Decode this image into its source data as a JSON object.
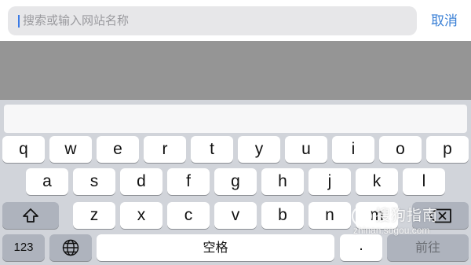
{
  "search": {
    "placeholder": "搜索或输入网站名称",
    "cancel_label": "取消"
  },
  "keyboard": {
    "row1": [
      "q",
      "w",
      "e",
      "r",
      "t",
      "y",
      "u",
      "i",
      "o",
      "p"
    ],
    "row2": [
      "a",
      "s",
      "d",
      "f",
      "g",
      "h",
      "j",
      "k",
      "l"
    ],
    "row3": [
      "z",
      "x",
      "c",
      "v",
      "b",
      "n",
      "m"
    ],
    "numbers_label": "123",
    "space_label": "空格",
    "period_label": ".",
    "go_label": "前往",
    "shift_icon": "shift-icon",
    "delete_icon": "delete-icon",
    "globe_icon": "globe-icon"
  },
  "watermark": {
    "name": "搜狗指南",
    "url": "zhinan.sogou.com"
  },
  "colors": {
    "accent": "#3a80d6",
    "overlay": "#959595",
    "keyboard_bg": "#d1d4da",
    "modifier_key": "#aeb3bd"
  }
}
